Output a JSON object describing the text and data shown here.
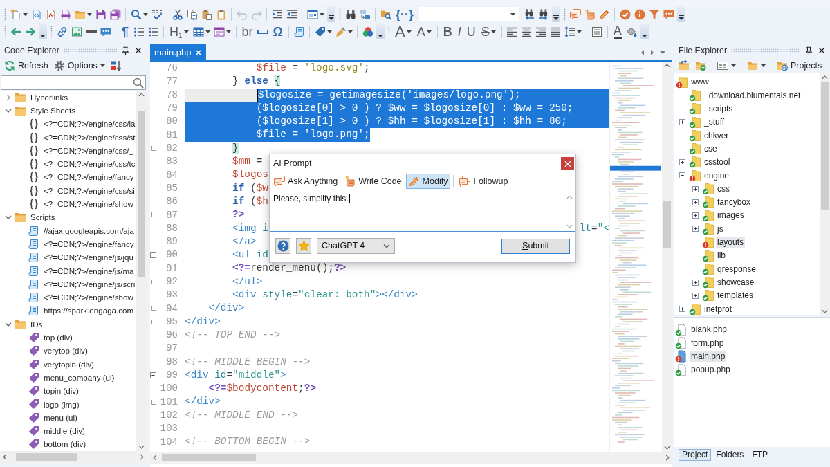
{
  "toolbar_rows": [
    [
      {
        "kind": "grip"
      },
      {
        "kind": "button",
        "disabled": false,
        "dropdown": true
      },
      {
        "kind": "button",
        "disabled": false
      },
      {
        "kind": "button",
        "disabled": false
      },
      {
        "kind": "button",
        "disabled": false
      },
      {
        "kind": "button",
        "disabled": false,
        "dropdown": true
      },
      {
        "kind": "button",
        "disabled": false
      },
      {
        "kind": "button",
        "disabled": false
      },
      {
        "kind": "separator"
      },
      {
        "kind": "button",
        "disabled": false,
        "dropdown": true
      },
      {
        "kind": "button",
        "disabled": false
      },
      {
        "kind": "separator"
      },
      {
        "kind": "button",
        "disabled": false
      },
      {
        "kind": "button",
        "disabled": false
      },
      {
        "kind": "button",
        "disabled": false
      },
      {
        "kind": "button",
        "disabled": false
      },
      {
        "kind": "separator"
      },
      {
        "kind": "button",
        "disabled": true
      },
      {
        "kind": "button",
        "disabled": true
      },
      {
        "kind": "separator"
      },
      {
        "kind": "button",
        "disabled": false
      },
      {
        "kind": "button",
        "disabled": false
      },
      {
        "kind": "separator"
      },
      {
        "kind": "button",
        "disabled": false,
        "dropdown": true
      },
      {
        "kind": "overflow"
      },
      {
        "kind": "grip"
      },
      {
        "kind": "button",
        "disabled": false
      },
      {
        "kind": "button",
        "disabled": false
      },
      {
        "kind": "separator"
      },
      {
        "kind": "button",
        "disabled": false
      },
      {
        "kind": "text-button",
        "text": "{··}",
        "disabled": false
      },
      {
        "kind": "combo"
      },
      {
        "kind": "button",
        "disabled": false
      },
      {
        "kind": "button",
        "disabled": false
      },
      {
        "kind": "overflow"
      },
      {
        "kind": "grip"
      },
      {
        "kind": "button",
        "disabled": false
      },
      {
        "kind": "button",
        "disabled": false
      },
      {
        "kind": "button",
        "disabled": false
      },
      {
        "kind": "separator"
      },
      {
        "kind": "button",
        "disabled": false
      },
      {
        "kind": "button",
        "disabled": false
      },
      {
        "kind": "button",
        "disabled": false
      },
      {
        "kind": "button",
        "disabled": false
      },
      {
        "kind": "overflow"
      }
    ],
    [
      {
        "kind": "grip"
      },
      {
        "kind": "button",
        "disabled": false
      },
      {
        "kind": "button",
        "disabled": false
      },
      {
        "kind": "overflow"
      },
      {
        "kind": "grip"
      },
      {
        "kind": "button",
        "disabled": false
      },
      {
        "kind": "button",
        "disabled": false
      },
      {
        "kind": "button",
        "disabled": false
      },
      {
        "kind": "button",
        "disabled": false
      },
      {
        "kind": "separator"
      },
      {
        "kind": "text-button",
        "text": "¶",
        "disabled": false
      },
      {
        "kind": "button",
        "disabled": false
      },
      {
        "kind": "button",
        "disabled": false
      },
      {
        "kind": "separator"
      },
      {
        "kind": "text-button",
        "text": "H$_{1}$",
        "disabled": false,
        "dropdown": true
      },
      {
        "kind": "button",
        "disabled": false,
        "dropdown": true
      },
      {
        "kind": "button",
        "disabled": false,
        "dropdown": true
      },
      {
        "kind": "separator"
      },
      {
        "kind": "text-button",
        "text": "br",
        "disabled": false
      },
      {
        "kind": "button",
        "disabled": false
      },
      {
        "kind": "text-button",
        "text": "Ω",
        "disabled": false
      },
      {
        "kind": "separator"
      },
      {
        "kind": "button",
        "disabled": false
      },
      {
        "kind": "separator"
      },
      {
        "kind": "button",
        "disabled": false,
        "dropdown": true
      },
      {
        "kind": "button",
        "disabled": false,
        "dropdown": true
      },
      {
        "kind": "separator"
      },
      {
        "kind": "button",
        "disabled": false
      },
      {
        "kind": "overflow"
      },
      {
        "kind": "grip"
      },
      {
        "kind": "text-button",
        "text": "A",
        "disabled": false,
        "dropdown": true
      },
      {
        "kind": "text-button",
        "text": "A",
        "disabled": false,
        "dropdown": true
      },
      {
        "kind": "separator"
      },
      {
        "kind": "text-button",
        "text": "B",
        "disabled": false
      },
      {
        "kind": "text-button",
        "text": "I",
        "disabled": false
      },
      {
        "kind": "text-button",
        "text": "U",
        "disabled": false
      },
      {
        "kind": "text-button",
        "text": "S",
        "disabled": false,
        "dropdown": true
      },
      {
        "kind": "separator"
      },
      {
        "kind": "button",
        "disabled": false
      },
      {
        "kind": "button",
        "disabled": false
      },
      {
        "kind": "button",
        "disabled": false
      },
      {
        "kind": "button",
        "disabled": false
      },
      {
        "kind": "button",
        "disabled": false,
        "dropdown": true
      },
      {
        "kind": "separator"
      },
      {
        "kind": "button",
        "disabled": false
      },
      {
        "kind": "separator"
      },
      {
        "kind": "text-button",
        "text": "A",
        "disabled": false
      },
      {
        "kind": "button",
        "disabled": false
      },
      {
        "kind": "overflow"
      }
    ]
  ],
  "code_explorer": {
    "title": "Code Explorer",
    "refresh_label": "Refresh",
    "options_label": "Options",
    "tree": [
      {
        "label": "Hyperlinks",
        "kind": "folder",
        "expanded": false,
        "selected": false
      },
      {
        "label": "Style Sheets",
        "kind": "folder",
        "expanded": true,
        "selected": false,
        "children": [
          {
            "label": "<?=CDN;?>/engine/css/la",
            "kind": "stylesheet",
            "selected": false
          },
          {
            "label": "<?=CDN;?>/engine/css/st",
            "kind": "stylesheet",
            "selected": false
          },
          {
            "label": "<?=CDN;?>/engine/css/_",
            "kind": "stylesheet",
            "selected": false
          },
          {
            "label": "<?=CDN;?>/engine/css/tc",
            "kind": "stylesheet",
            "selected": false
          },
          {
            "label": "<?=CDN;?>/engine/fancy",
            "kind": "stylesheet",
            "selected": false
          },
          {
            "label": "<?=CDN;?>/engine/css/si",
            "kind": "stylesheet",
            "selected": false
          },
          {
            "label": "<?=CDN;?>/engine/show",
            "kind": "stylesheet",
            "selected": false
          }
        ]
      },
      {
        "label": "Scripts",
        "kind": "folder",
        "expanded": true,
        "selected": false,
        "children": [
          {
            "label": "//ajax.googleapis.com/aja",
            "kind": "script",
            "selected": false
          },
          {
            "label": "<?=CDN;?>/engine/fancy",
            "kind": "script",
            "selected": false
          },
          {
            "label": "<?=CDN;?>/engine/js/jqu",
            "kind": "script",
            "selected": false
          },
          {
            "label": "<?=CDN;?>/engine/js/ma",
            "kind": "script",
            "selected": false
          },
          {
            "label": "<?=CDN;?>/engine/js/scri",
            "kind": "script",
            "selected": false
          },
          {
            "label": "<?=CDN;?>/engine/show",
            "kind": "script",
            "selected": false
          },
          {
            "label": "https://spark.engaga.com",
            "kind": "script",
            "selected": false
          }
        ]
      },
      {
        "label": "IDs",
        "kind": "folder",
        "expanded": true,
        "selected": false,
        "children": [
          {
            "label": "top (div)",
            "kind": "id",
            "selected": false
          },
          {
            "label": "verytop (div)",
            "kind": "id",
            "selected": false
          },
          {
            "label": "verytopin (div)",
            "kind": "id",
            "selected": false
          },
          {
            "label": "menu_company (ul)",
            "kind": "id",
            "selected": false
          },
          {
            "label": "topin (div)",
            "kind": "id",
            "selected": false
          },
          {
            "label": "logo (img)",
            "kind": "id",
            "selected": false
          },
          {
            "label": "menu (ul)",
            "kind": "id",
            "selected": false
          },
          {
            "label": "middle (div)",
            "kind": "id",
            "selected": false
          },
          {
            "label": "bottom (div)",
            "kind": "id",
            "selected": false
          }
        ]
      }
    ]
  },
  "editor": {
    "tabs": [
      {
        "label": "main.php",
        "selected": true
      }
    ],
    "lines": [
      {
        "num": "76",
        "selected": false,
        "tokens": [
          {
            "kind": "var",
            "text": "            $file"
          },
          {
            "kind": "plain",
            "text": " = "
          },
          {
            "kind": "str",
            "text": "'logo.svg'"
          },
          {
            "kind": "plain",
            "text": ";"
          }
        ]
      },
      {
        "num": "77",
        "selected": false,
        "tokens": [
          {
            "kind": "plain",
            "text": "        } "
          },
          {
            "kind": "kw",
            "text": "else "
          },
          {
            "kind": "match",
            "text": "{"
          }
        ]
      },
      {
        "num": "78",
        "current": true,
        "selected": true,
        "tokens": [
          {
            "kind": "var",
            "text": "            $logosize"
          },
          {
            "kind": "plain",
            "text": " = getimagesize("
          },
          {
            "kind": "str",
            "text": "'images/logo.png'"
          },
          {
            "kind": "plain",
            "text": ");"
          }
        ]
      },
      {
        "num": "79",
        "selected": true,
        "tokens": [
          {
            "kind": "plain",
            "text": "            ("
          },
          {
            "kind": "var",
            "text": "$logosize"
          },
          {
            "kind": "plain",
            "text": "[0] > 0 ) ? "
          },
          {
            "kind": "var",
            "text": "$ww"
          },
          {
            "kind": "plain",
            "text": " = "
          },
          {
            "kind": "var",
            "text": "$logosize"
          },
          {
            "kind": "plain",
            "text": "[0] : "
          },
          {
            "kind": "var",
            "text": "$ww"
          },
          {
            "kind": "plain",
            "text": " = 250;"
          }
        ]
      },
      {
        "num": "80",
        "selected": true,
        "tokens": [
          {
            "kind": "plain",
            "text": "            ("
          },
          {
            "kind": "var",
            "text": "$logosize"
          },
          {
            "kind": "plain",
            "text": "[1] > 0 ) ? "
          },
          {
            "kind": "var",
            "text": "$hh"
          },
          {
            "kind": "plain",
            "text": " = "
          },
          {
            "kind": "var",
            "text": "$logosize"
          },
          {
            "kind": "plain",
            "text": "[1] : "
          },
          {
            "kind": "var",
            "text": "$hh"
          },
          {
            "kind": "plain",
            "text": " = 80;"
          }
        ]
      },
      {
        "num": "81",
        "selected": true,
        "tokens": [
          {
            "kind": "var",
            "text": "            $file"
          },
          {
            "kind": "plain",
            "text": " = "
          },
          {
            "kind": "str",
            "text": "'logo.png'"
          },
          {
            "kind": "plain",
            "text": ";"
          }
        ]
      },
      {
        "num": "82",
        "selected": false,
        "fold_end": true,
        "tokens": [
          {
            "kind": "match",
            "text": "        }"
          }
        ]
      },
      {
        "num": "83",
        "selected": false,
        "tokens": [
          {
            "kind": "var",
            "text": "        $mm"
          },
          {
            "kind": "plain",
            "text": " ="
          }
        ]
      },
      {
        "num": "84",
        "selected": false,
        "tokens": [
          {
            "kind": "var",
            "text": "        $logos"
          }
        ]
      },
      {
        "num": "85",
        "selected": false,
        "tokens": [
          {
            "kind": "kw",
            "text": "        if"
          },
          {
            "kind": "plain",
            "text": " ("
          },
          {
            "kind": "var",
            "text": "$w"
          }
        ]
      },
      {
        "num": "86",
        "selected": false,
        "tokens": [
          {
            "kind": "kw",
            "text": "        if"
          },
          {
            "kind": "plain",
            "text": " ("
          },
          {
            "kind": "var",
            "text": "$h"
          }
        ]
      },
      {
        "num": "87",
        "selected": false,
        "fold_end": true,
        "tokens": [
          {
            "kind": "php",
            "text": "        ?>"
          }
        ]
      },
      {
        "num": "88",
        "selected": false,
        "tokens": [
          {
            "kind": "tag",
            "text": "        <img"
          },
          {
            "kind": "attr",
            "text": " i"
          }
        ],
        "tail": [
          {
            "kind": "attr",
            "text": "lt"
          },
          {
            "kind": "plain",
            "text": "="
          },
          {
            "kind": "val",
            "text": "\"<"
          }
        ]
      },
      {
        "num": "89",
        "selected": false,
        "tokens": [
          {
            "kind": "tag",
            "text": "        </a>"
          }
        ]
      },
      {
        "num": "90",
        "selected": false,
        "expanded": true,
        "tokens": [
          {
            "kind": "tag",
            "text": "        <ul"
          },
          {
            "kind": "attr",
            "text": " id"
          }
        ]
      },
      {
        "num": "91",
        "selected": false,
        "tokens": [
          {
            "kind": "php",
            "text": "        <?="
          },
          {
            "kind": "plain",
            "text": "render_menu();"
          },
          {
            "kind": "php",
            "text": "?>"
          }
        ]
      },
      {
        "num": "92",
        "selected": false,
        "fold_end": true,
        "tokens": [
          {
            "kind": "tag",
            "text": "        </ul>"
          }
        ]
      },
      {
        "num": "93",
        "selected": false,
        "tokens": [
          {
            "kind": "tag",
            "text": "        <div"
          },
          {
            "kind": "attr",
            "text": " style"
          },
          {
            "kind": "plain",
            "text": "="
          },
          {
            "kind": "val",
            "text": "\"clear: both\""
          },
          {
            "kind": "tag",
            "text": "></div>"
          }
        ]
      },
      {
        "num": "94",
        "selected": false,
        "fold_end": true,
        "tokens": [
          {
            "kind": "tag",
            "text": "    </div>"
          }
        ]
      },
      {
        "num": "95",
        "selected": false,
        "fold_end": true,
        "tokens": [
          {
            "kind": "tag",
            "text": "</div>"
          }
        ]
      },
      {
        "num": "96",
        "selected": false,
        "tokens": [
          {
            "kind": "cmt",
            "text": "<!-- TOP END -->"
          }
        ]
      },
      {
        "num": "97"
      },
      {
        "num": "98",
        "selected": false,
        "tokens": [
          {
            "kind": "cmt",
            "text": "<!-- MIDDLE BEGIN -->"
          }
        ]
      },
      {
        "num": "99",
        "selected": false,
        "expanded": true,
        "tokens": [
          {
            "kind": "tag",
            "text": "<div"
          },
          {
            "kind": "attr",
            "text": " id"
          },
          {
            "kind": "plain",
            "text": "="
          },
          {
            "kind": "val",
            "text": "\"middle\""
          },
          {
            "kind": "tag",
            "text": ">"
          }
        ]
      },
      {
        "num": "100",
        "selected": false,
        "tokens": [
          {
            "kind": "php",
            "text": "    <?="
          },
          {
            "kind": "var",
            "text": "$bodycontent"
          },
          {
            "kind": "plain",
            "text": ";"
          },
          {
            "kind": "php",
            "text": "?>"
          }
        ]
      },
      {
        "num": "101",
        "selected": false,
        "fold_end": true,
        "tokens": [
          {
            "kind": "tag",
            "text": "</div>"
          }
        ]
      },
      {
        "num": "102",
        "selected": false,
        "tokens": [
          {
            "kind": "cmt",
            "text": "<!-- MIDDLE END -->"
          }
        ]
      },
      {
        "num": "103"
      },
      {
        "num": "104",
        "selected": false,
        "tokens": [
          {
            "kind": "cmt",
            "text": "<!-- BOTTOM BEGIN -->"
          }
        ]
      }
    ]
  },
  "ai_prompt": {
    "title": "AI Prompt",
    "modes": [
      {
        "kind": "ask",
        "label": "Ask Anything",
        "selected": false
      },
      {
        "kind": "write",
        "label": "Write Code",
        "selected": false
      },
      {
        "kind": "modify",
        "label": "Modify",
        "selected": true
      },
      {
        "kind": "followup",
        "label": "Followup",
        "selected": false
      }
    ],
    "prompt": {
      "value": "Please, simplify this."
    },
    "model": {
      "value": "ChatGPT 4"
    },
    "submit_label": "Submit"
  },
  "file_explorer": {
    "title": "File Explorer",
    "projects_label": "Projects",
    "tree": [
      {
        "label": "www",
        "error": true,
        "selected": false,
        "children": [
          {
            "label": "_download.blumentals.net",
            "error": false,
            "selected": false
          },
          {
            "label": "_scripts",
            "error": false,
            "selected": false
          },
          {
            "label": "_stuff",
            "error": false,
            "expanded": false,
            "selected": false
          },
          {
            "label": "chkver",
            "error": false,
            "selected": false
          },
          {
            "label": "cse",
            "error": false,
            "selected": false
          },
          {
            "label": "csstool",
            "error": false,
            "expanded": false,
            "selected": false
          },
          {
            "label": "engine",
            "error": true,
            "expanded": true,
            "selected": false,
            "children": [
              {
                "label": "css",
                "error": false,
                "expanded": false,
                "selected": false
              },
              {
                "label": "fancybox",
                "error": false,
                "expanded": false,
                "selected": false
              },
              {
                "label": "images",
                "error": false,
                "expanded": false,
                "selected": false
              },
              {
                "label": "js",
                "error": false,
                "expanded": false,
                "selected": false
              },
              {
                "label": "layouts",
                "error": true,
                "selected": true
              },
              {
                "label": "lib",
                "error": false,
                "selected": false
              },
              {
                "label": "qresponse",
                "error": false,
                "selected": false
              },
              {
                "label": "showcase",
                "error": false,
                "expanded": false,
                "selected": false
              },
              {
                "label": "templates",
                "error": false,
                "expanded": false,
                "selected": false
              }
            ]
          },
          {
            "label": "inetprot",
            "error": false,
            "expanded": false,
            "selected": false
          }
        ]
      }
    ],
    "files": [
      {
        "label": "blank.php",
        "error": false,
        "selected": false
      },
      {
        "label": "form.php",
        "error": false,
        "selected": false
      },
      {
        "label": "main.php",
        "error": true,
        "selected": true
      },
      {
        "label": "popup.php",
        "error": false,
        "selected": false
      }
    ],
    "tabs": [
      {
        "label": "Project",
        "selected": true
      },
      {
        "label": "Folders",
        "selected": false
      },
      {
        "label": "FTP",
        "selected": false
      }
    ]
  }
}
